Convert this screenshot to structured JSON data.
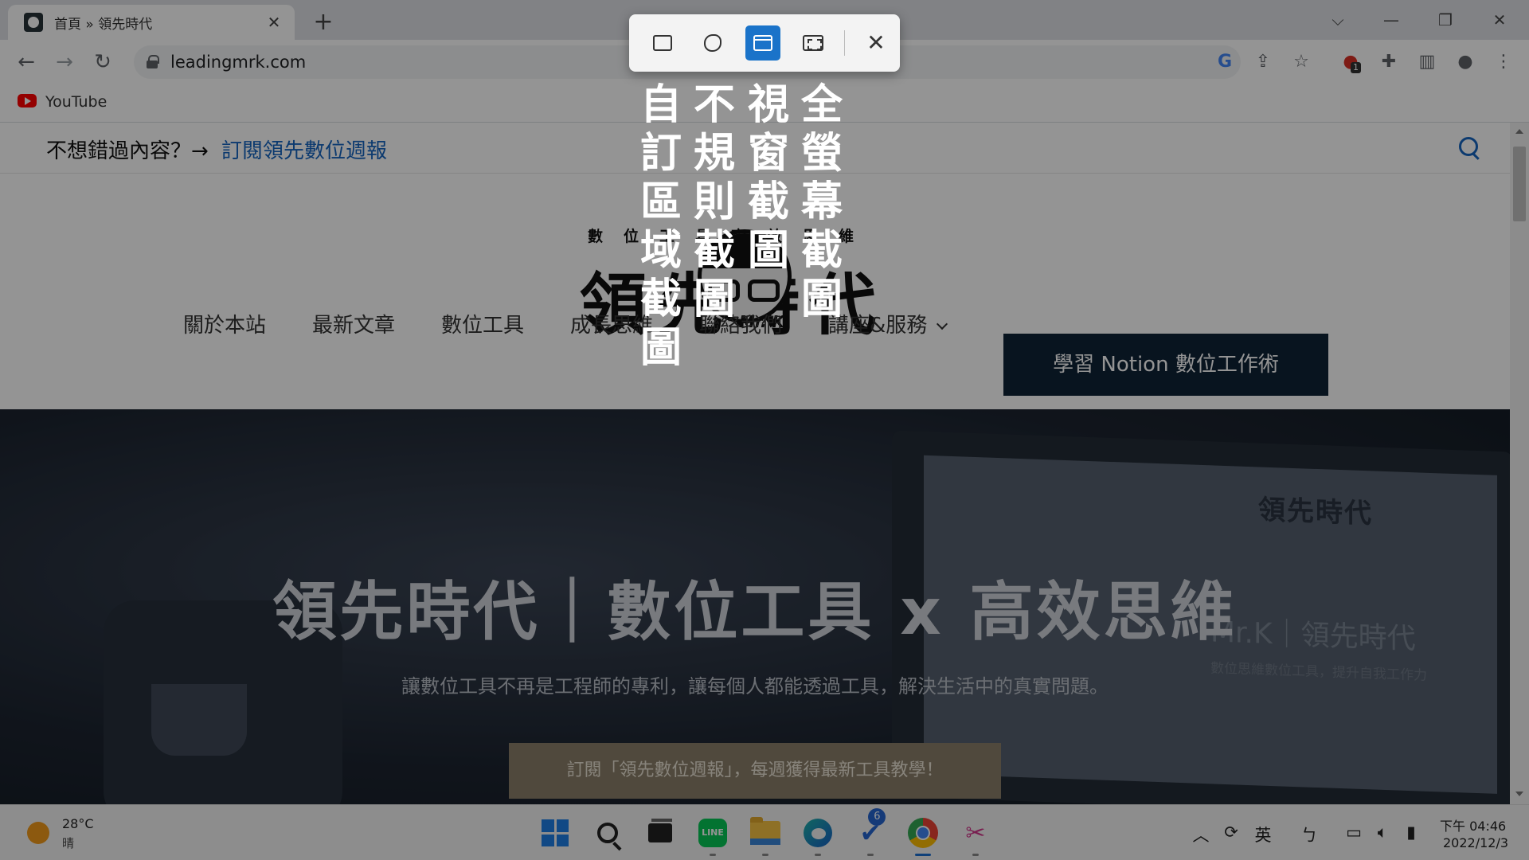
{
  "browser": {
    "tab_title": "首頁 » 領先時代",
    "url": "leadingmrk.com",
    "bookmark_label": "YouTube",
    "extension_badge": "1"
  },
  "site": {
    "promo_text": "不想錯過內容？→",
    "promo_link": "訂閱領先數位週報",
    "logo_small": "數位工具高效思維",
    "logo_big": "領先時代",
    "logo_mr": "Mr. K",
    "menu": [
      {
        "label": "關於本站"
      },
      {
        "label": "最新文章"
      },
      {
        "label": "數位工具"
      },
      {
        "label": "成長思維"
      },
      {
        "label": "聯絡我們"
      },
      {
        "label": "講座&服務"
      }
    ],
    "cta_label": "學習 Notion 數位工作術",
    "hero_title": "領先時代｜數位工具 x 高效思維",
    "hero_subtitle": "讓數位工具不再是工程師的專利，讓每個人都能透過工具，解決生活中的真實問題。",
    "hero_button": "訂閱「領先數位週報」，每週獲得最新工具教學！",
    "hero_screen_logo": "領先時代",
    "hero_screen_text": "Mr.K｜領先時代",
    "hero_screen_sub": "數位思維數位工具，提升自我工作力"
  },
  "snipping_tool": {
    "modes": [
      {
        "label": "自訂區域截圖"
      },
      {
        "label": "不規則截圖"
      },
      {
        "label": "視窗截圖"
      },
      {
        "label": "全螢幕截圖"
      }
    ],
    "active_mode": "視窗截圖",
    "active_color": "#1a73c9"
  },
  "taskbar": {
    "weather_temp": "28°C",
    "weather_desc": "晴",
    "todo_badge": "6",
    "ime_label": "英",
    "time": "下午 04:46",
    "date": "2022/12/3"
  }
}
